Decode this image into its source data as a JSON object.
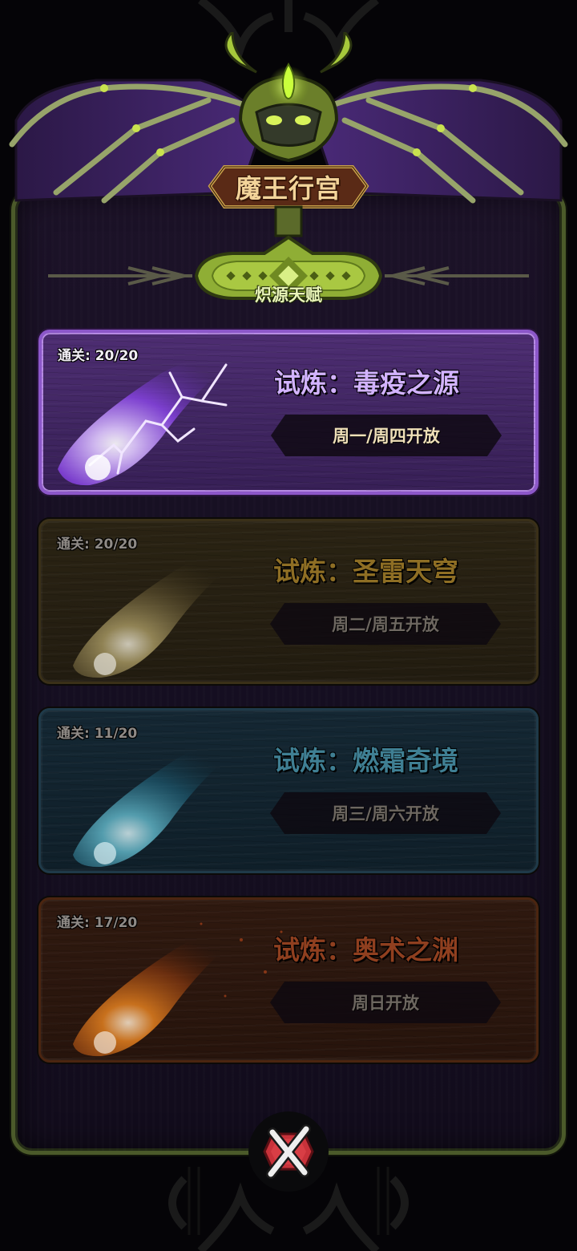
{
  "header": {
    "title": "魔王行宫",
    "subtitle": "炽源天赋"
  },
  "trials": [
    {
      "clears_label": "通关: 20/20",
      "title": "试炼：毒疫之源",
      "schedule": "周一/周四开放",
      "state": "open",
      "accent": "#8c57c9"
    },
    {
      "clears_label": "通关: 20/20",
      "title": "试炼：圣雷天穹",
      "schedule": "周二/周五开放",
      "state": "locked",
      "accent": "#8e6e24"
    },
    {
      "clears_label": "通关: 11/20",
      "title": "试炼：燃霜奇境",
      "schedule": "周三/周六开放",
      "state": "locked",
      "accent": "#3f7f93"
    },
    {
      "clears_label": "通关: 17/20",
      "title": "试炼：奥术之渊",
      "schedule": "周日开放",
      "state": "locked",
      "accent": "#8f3f1f"
    }
  ],
  "icons": {
    "crest": "demon-skull-icon",
    "close": "close-icon"
  }
}
